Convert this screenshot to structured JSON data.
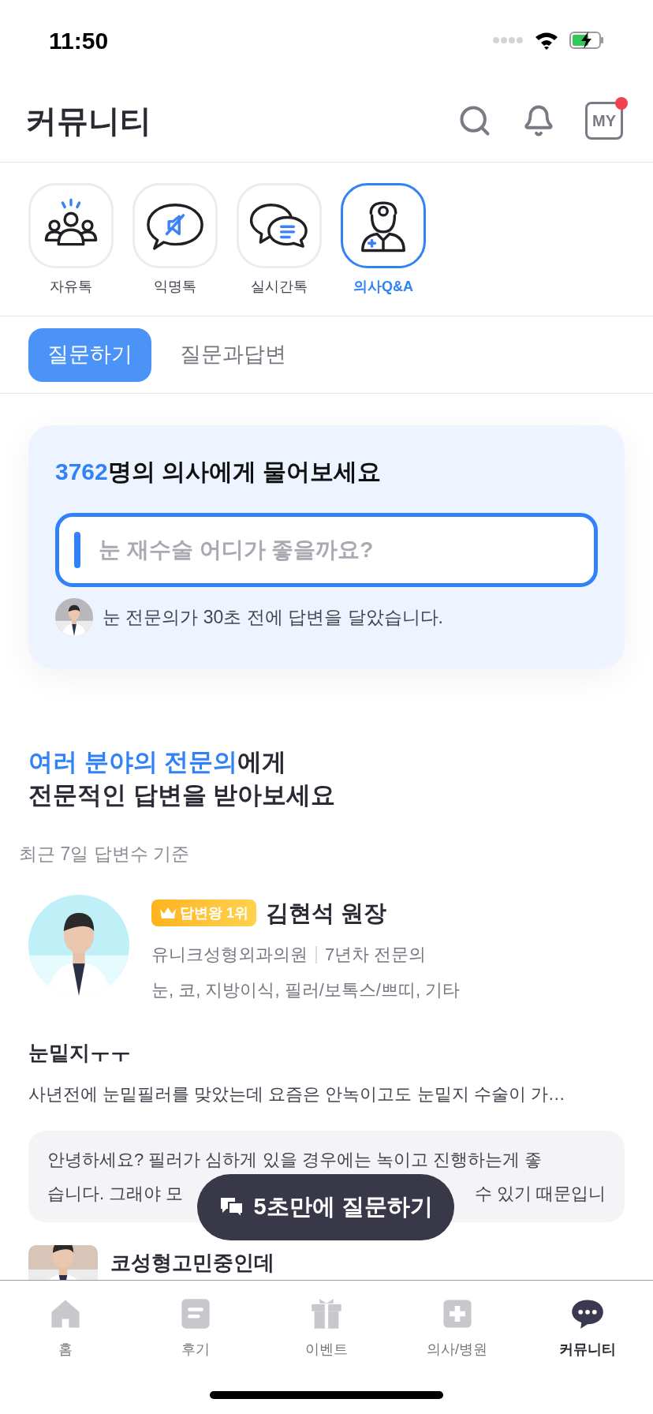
{
  "status_bar": {
    "time": "11:50"
  },
  "header": {
    "title": "커뮤니티",
    "my_label": "MY",
    "notification_dot": true
  },
  "categories": [
    {
      "label": "자유톡",
      "kind": "people",
      "selected": false
    },
    {
      "label": "익명톡",
      "kind": "anonymous",
      "selected": false
    },
    {
      "label": "실시간톡",
      "kind": "chat",
      "selected": false
    },
    {
      "label": "의사Q&A",
      "kind": "doctor",
      "selected": true
    }
  ],
  "subtabs": [
    {
      "label": "질문하기",
      "selected": true
    },
    {
      "label": "질문과답변",
      "selected": false
    }
  ],
  "ask_card": {
    "count": "3762",
    "headline": "명의 의사에게 물어보세요",
    "placeholder": "눈 재수술 어디가 좋을까요?",
    "recent_answer": "눈 전문의가 30초 전에 답변을 달았습니다."
  },
  "experts": {
    "heading_highlight": "여러 분야의 전문의",
    "heading_rest": "에게",
    "heading_line2": "전문적인 답변을 받아보세요",
    "basis": "최근 7일 답변수 기준"
  },
  "doctor": {
    "badge": "답변왕 1위",
    "name": "김현석 원장",
    "clinic": "유니크성형외과의원",
    "career": "7년차 전문의",
    "specialties": "눈, 코, 지방이식, 필러/보톡스/쁘띠, 기타"
  },
  "post": {
    "title": "눈밑지ㅜㅜ",
    "excerpt": "사년전에 눈밑필러를 맞았는데 요즘은 안녹이고도 눈밑지 수술이 가…",
    "answer_line1": "안녕하세요? 필러가 심하게 있을 경우에는 녹이고 진행하는게 좋",
    "answer_line2_parts": [
      "습니다. 그래야 모",
      "수 있기 때문입니"
    ]
  },
  "next_post": {
    "title": "코성형고민중인데"
  },
  "fab": {
    "label": "5초만에 질문하기"
  },
  "tab_bar": [
    {
      "label": "홈",
      "kind": "home",
      "selected": false
    },
    {
      "label": "후기",
      "kind": "review",
      "selected": false
    },
    {
      "label": "이벤트",
      "kind": "gift",
      "selected": false
    },
    {
      "label": "의사/병원",
      "kind": "hospital",
      "selected": false
    },
    {
      "label": "커뮤니티",
      "kind": "community",
      "selected": true
    }
  ]
}
